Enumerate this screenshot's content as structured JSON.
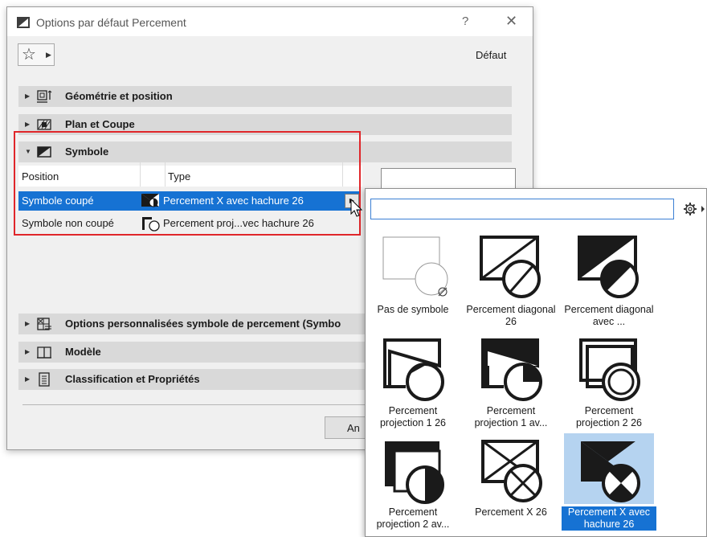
{
  "dialog": {
    "title": "Options par défaut Percement",
    "help_glyph": "?",
    "close_glyph": "✕",
    "favorites_icon": "star-icon",
    "default_label": "Défaut",
    "panels": [
      {
        "label": "Géométrie et position",
        "icon": "geometry-position-icon",
        "expanded": false
      },
      {
        "label": "Plan et Coupe",
        "icon": "floor-plan-section-icon",
        "expanded": false
      },
      {
        "label": "Symbole",
        "icon": "symbol-icon",
        "expanded": true
      },
      {
        "label": "Options personnalisées symbole de percement (Symbo",
        "icon": "custom-options-icon",
        "expanded": false
      },
      {
        "label": "Modèle",
        "icon": "model-icon",
        "expanded": false
      },
      {
        "label": "Classification et Propriétés",
        "icon": "classification-icon",
        "expanded": false
      }
    ],
    "symbol_table": {
      "headers": {
        "position": "Position",
        "type": "Type"
      },
      "rows": [
        {
          "position": "Symbole coupé",
          "type": "Percement X avec hachure 26",
          "selected": true
        },
        {
          "position": "Symbole non coupé",
          "type": "Percement proj...vec hachure 26",
          "selected": false
        }
      ]
    },
    "cancel_button": "An",
    "highlight_color": "#e0262a",
    "selection_color": "#1672d3"
  },
  "popup": {
    "search_value": "",
    "settings_icon": "gear-icon",
    "symbols": [
      {
        "label": "Pas de symbole",
        "kind": "none",
        "selected": false
      },
      {
        "label": "Percement diagonal 26",
        "kind": "diagonal",
        "selected": false
      },
      {
        "label": "Percement diagonal avec ...",
        "kind": "diagonal-hatch",
        "selected": false
      },
      {
        "label": "Percement projection 1 26",
        "kind": "projection1",
        "selected": false
      },
      {
        "label": "Percement projection 1 av...",
        "kind": "projection1-hatch",
        "selected": false
      },
      {
        "label": "Percement projection 2 26",
        "kind": "projection2",
        "selected": false
      },
      {
        "label": "Percement projection 2 av...",
        "kind": "projection2-hatch",
        "selected": false
      },
      {
        "label": "Percement X 26",
        "kind": "x",
        "selected": false
      },
      {
        "label": "Percement X avec hachure 26",
        "kind": "x-hatch",
        "selected": true
      }
    ]
  }
}
